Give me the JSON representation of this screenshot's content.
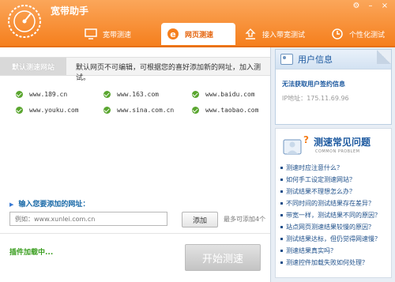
{
  "app": {
    "title": "宽带助手"
  },
  "window_buttons": [
    "gear-icon",
    "minimize-icon",
    "close-icon"
  ],
  "tabs": [
    {
      "label": "宽带测速",
      "icon": "monitor-icon",
      "active": false
    },
    {
      "label": "网页测速",
      "icon": "ie-icon",
      "active": true
    },
    {
      "label": "接入带宽测试",
      "icon": "upload-icon",
      "active": false
    },
    {
      "label": "个性化测试",
      "icon": "clock-icon",
      "active": false
    }
  ],
  "section": {
    "tab_label": "默认测速网站",
    "description": "默认网页不可编辑，可根据您的喜好添加新的网址，加入测试。"
  },
  "sites": [
    "www.189.cn",
    "www.163.com",
    "www.baidu.com",
    "www.youku.com",
    "www.sina.com.cn",
    "www.taobao.com"
  ],
  "add": {
    "label": "输入您要添加的网址：",
    "placeholder": "例如：www.xunlei.com.cn",
    "button": "添加",
    "hint": "最多可添加4个"
  },
  "status": {
    "plugin": "插件加载中..."
  },
  "start_button": "开始测速",
  "user": {
    "title": "用户信息",
    "status": "无法获取用户签约信息",
    "ip_label": "IP地址：",
    "ip": "175.11.69.96"
  },
  "faq": {
    "title": "测速常见问题",
    "subtitle": "COMMON PROBLEM",
    "items": [
      "测速时应注意什么？",
      "如何手工设定测速网站？",
      "测试结果不理想怎么办？",
      "不同时间的测试结果存在差异？",
      "带宽一样，测试结果不同的原因？",
      "站点网页测速结果较慢的原因？",
      "测试结果达标，但仍觉得网速慢？",
      "测速结果真实吗？",
      "测速控件加载失败如何处理？"
    ]
  },
  "colors": {
    "header": "#f58a2a",
    "accent_blue": "#1e5aa0",
    "check_green": "#5aa62f"
  }
}
